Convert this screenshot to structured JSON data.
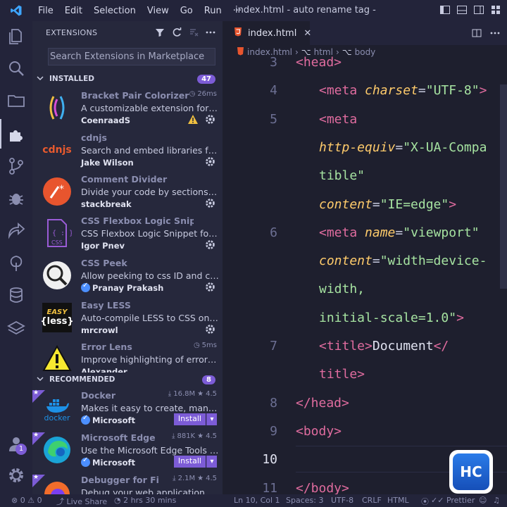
{
  "titlebar": {
    "menu": [
      "File",
      "Edit",
      "Selection",
      "View",
      "Go",
      "Run",
      "···"
    ],
    "window_title": "index.html - auto rename tag - Visual..."
  },
  "sidebar": {
    "header": "EXTENSIONS",
    "search_placeholder": "Search Extensions in Marketplace",
    "installed_label": "INSTALLED",
    "installed_count": "47",
    "recommended_label": "RECOMMENDED",
    "recommended_count": "8",
    "installed": [
      {
        "name": "Bracket Pair Colorizer",
        "meta": "26ms",
        "desc": "A customizable extension for col...",
        "publisher": "CoenraadS",
        "warning": true
      },
      {
        "name": "cdnjs",
        "meta": "",
        "desc": "Search and embed libraries from ...",
        "publisher": "Jake Wilson"
      },
      {
        "name": "Comment Divider",
        "meta": "",
        "desc": "Divide your code by sections with...",
        "publisher": "stackbreak"
      },
      {
        "name": "CSS Flexbox Logic Snippet for ...",
        "meta": "",
        "desc": "CSS Flexbox Logic Snippet for VS ...",
        "publisher": "Igor Pnev"
      },
      {
        "name": "CSS Peek",
        "meta": "",
        "desc": "Allow peeking to css ID and class...",
        "publisher": "Pranay Prakash",
        "verified": true
      },
      {
        "name": "Easy LESS",
        "meta": "",
        "desc": "Auto-compile LESS to CSS on save",
        "publisher": "mrcrowl"
      },
      {
        "name": "Error Lens",
        "meta": "5ms",
        "desc": "Improve highlighting of errors, w...",
        "publisher": "Alexander"
      }
    ],
    "recommended": [
      {
        "name": "Docker",
        "downloads": "16.8M",
        "rating": "4.5",
        "desc": "Makes it easy to create, manage, ...",
        "publisher": "Microsoft",
        "install": "Install"
      },
      {
        "name": "Microsoft Edge To...",
        "downloads": "881K",
        "rating": "4.5",
        "desc": "Use the Microsoft Edge Tools fro...",
        "publisher": "Microsoft",
        "install": "Install"
      },
      {
        "name": "Debugger for Fire...",
        "downloads": "2.1M",
        "rating": "4.5",
        "desc": "Debug your web application or b...",
        "publisher": ""
      }
    ],
    "logo_text": {
      "cdnjs": "cdnjs",
      "easy": "EASY",
      "less": "{less}",
      "css": "CSS",
      "docker": "docker"
    }
  },
  "editor": {
    "tab_label": "index.html",
    "breadcrumb": [
      "index.html",
      "html",
      "body"
    ],
    "lines": [
      {
        "ln": "3",
        "parts": [
          [
            "t",
            "<head>"
          ]
        ]
      },
      {
        "ln": "4",
        "parts": [
          [
            "t",
            "<meta "
          ],
          [
            "a",
            "charset"
          ],
          [
            "p",
            "="
          ],
          [
            "s",
            "\"UTF-8\""
          ],
          [
            "t",
            ">"
          ]
        ]
      },
      {
        "ln": "5",
        "parts": [
          [
            "t",
            "<meta"
          ]
        ]
      },
      {
        "ln": "",
        "parts": [
          [
            "a",
            "http-equiv"
          ],
          [
            "p",
            "="
          ],
          [
            "s",
            "\"X-UA-Compa"
          ]
        ]
      },
      {
        "ln": "",
        "parts": [
          [
            "s",
            "tible\""
          ]
        ]
      },
      {
        "ln": "",
        "parts": [
          [
            "a",
            "content"
          ],
          [
            "p",
            "="
          ],
          [
            "s",
            "\"IE=edge\""
          ],
          [
            "t",
            ">"
          ]
        ]
      },
      {
        "ln": "6",
        "parts": [
          [
            "t",
            "<meta "
          ],
          [
            "a",
            "name"
          ],
          [
            "p",
            "="
          ],
          [
            "s",
            "\"viewport\""
          ]
        ]
      },
      {
        "ln": "",
        "parts": [
          [
            "a",
            "content"
          ],
          [
            "p",
            "="
          ],
          [
            "s",
            "\"width=device-"
          ]
        ]
      },
      {
        "ln": "",
        "parts": [
          [
            "s",
            "width,"
          ]
        ]
      },
      {
        "ln": "",
        "parts": [
          [
            "s",
            "initial-scale=1.0\""
          ],
          [
            "t",
            ">"
          ]
        ]
      },
      {
        "ln": "7",
        "parts": [
          [
            "t",
            "<title>"
          ],
          [
            "w",
            "Document"
          ],
          [
            "t",
            "</"
          ]
        ]
      },
      {
        "ln": "",
        "parts": [
          [
            "t",
            "title>"
          ]
        ]
      },
      {
        "ln": "8",
        "parts": [
          [
            "t",
            "</head>"
          ]
        ]
      },
      {
        "ln": "9",
        "parts": [
          [
            "t",
            "<body>"
          ]
        ]
      },
      {
        "ln": "10",
        "parts": []
      },
      {
        "ln": "11",
        "parts": [
          [
            "t",
            "</body>"
          ]
        ]
      }
    ],
    "watermark": "HC"
  },
  "statusbar": {
    "errors": "0",
    "warnings": "0",
    "live_share": "Live Share",
    "time": "2 hrs 30 mins",
    "position": "Ln 10, Col 1",
    "spaces": "Spaces: 3",
    "encoding": "UTF-8",
    "eol": "CRLF",
    "language": "HTML",
    "prettier": "Prettier"
  },
  "activity": {
    "accounts_badge": "1"
  },
  "colors": {
    "accent": "#7c5cd6",
    "tag": "#e06c9f",
    "attr": "#ffcb6b",
    "string": "#a6e3a1"
  }
}
